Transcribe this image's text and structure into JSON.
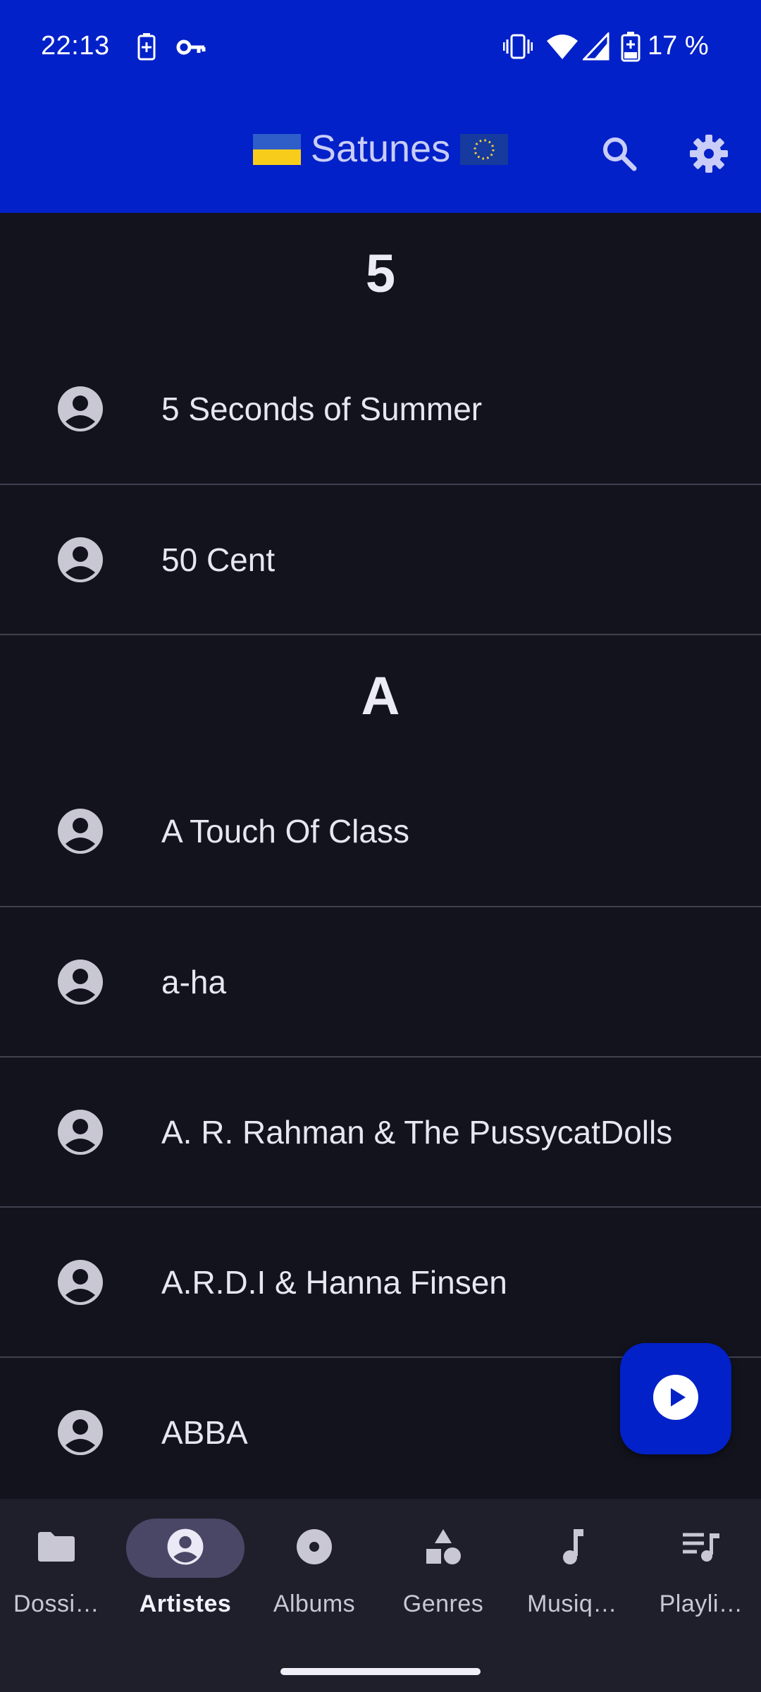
{
  "status_bar": {
    "time": "22:13",
    "battery_percent": "17 %",
    "icons": [
      "battery-saver-icon",
      "vpn-key-icon",
      "vibrate-icon",
      "wifi-icon",
      "signal-icon",
      "battery-icon"
    ]
  },
  "app_bar": {
    "title": "Satunes",
    "left_flag": "ukraine-flag-icon",
    "right_flag": "eu-flag-icon",
    "actions": [
      "search-icon",
      "settings-icon"
    ]
  },
  "sections": [
    {
      "letter": "5",
      "artists": [
        "5 Seconds of Summer",
        "50 Cent"
      ]
    },
    {
      "letter": "A",
      "artists": [
        "A Touch Of Class",
        "a-ha",
        "A. R. Rahman & The PussycatDolls",
        "A.R.D.I & Hanna Finsen",
        "ABBA"
      ]
    }
  ],
  "fab": {
    "icon": "play-circle-icon"
  },
  "bottom_nav": {
    "items": [
      {
        "label": "Dossi…",
        "icon": "folder-icon",
        "active": false
      },
      {
        "label": "Artistes",
        "icon": "artist-icon",
        "active": true
      },
      {
        "label": "Albums",
        "icon": "album-icon",
        "active": false
      },
      {
        "label": "Genres",
        "icon": "genres-icon",
        "active": false
      },
      {
        "label": "Musiq…",
        "icon": "music-note-icon",
        "active": false
      },
      {
        "label": "Playli…",
        "icon": "playlist-icon",
        "active": false
      }
    ]
  },
  "colors": {
    "primary": "#0221c8",
    "background": "#12131c",
    "nav_background": "#1e1f2b",
    "active_pill": "#4a4766"
  }
}
